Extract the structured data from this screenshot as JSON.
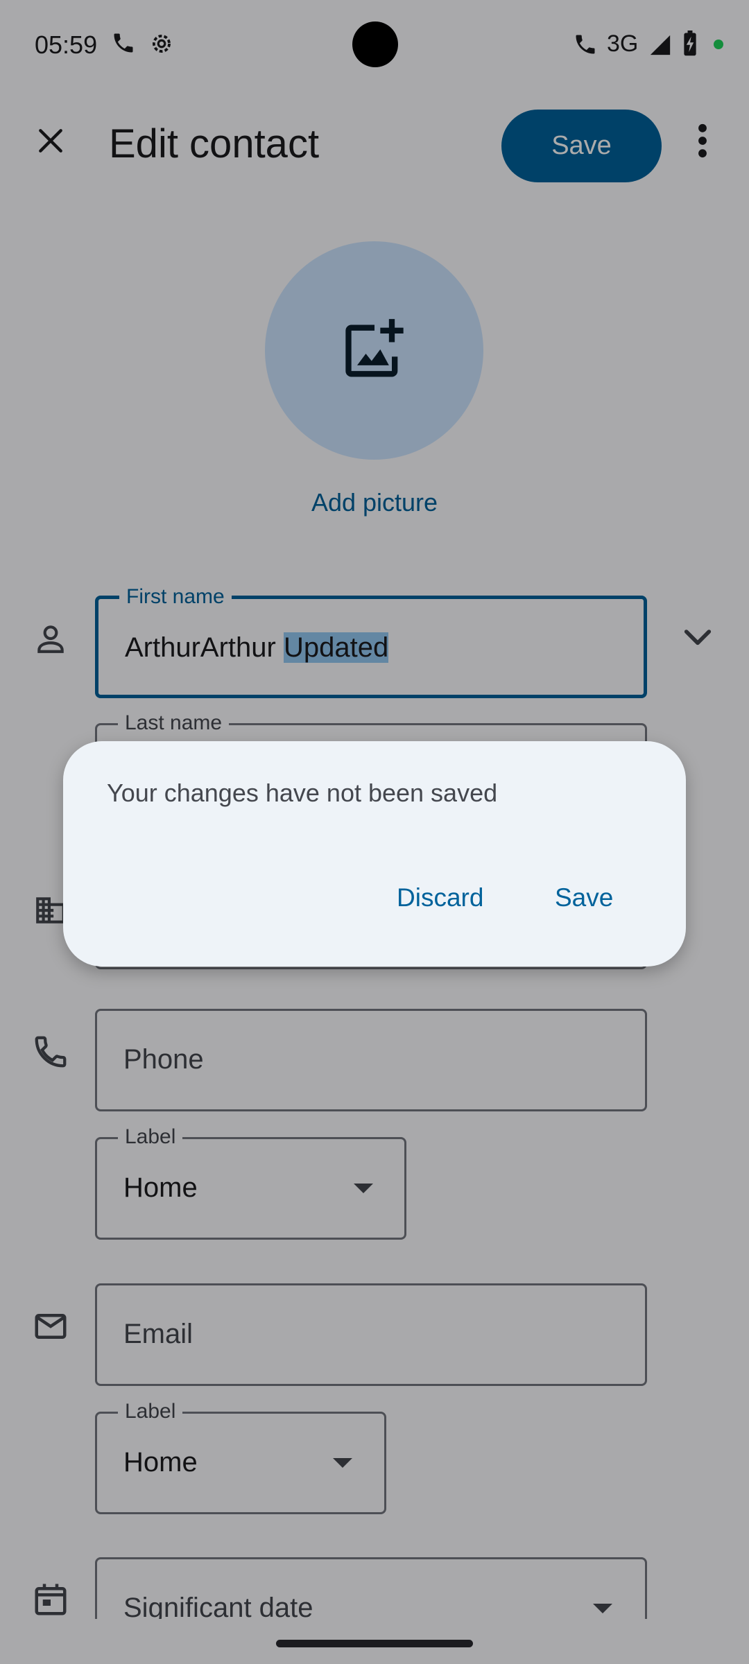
{
  "status_bar": {
    "time": "05:59",
    "network": "3G"
  },
  "top_bar": {
    "title": "Edit contact",
    "save_label": "Save",
    "close_icon": "close-icon",
    "more_icon": "more-vert-icon"
  },
  "avatar": {
    "icon": "add-photo-icon",
    "add_picture_label": "Add picture"
  },
  "fields": {
    "first_name": {
      "label": "First name",
      "value_plain": "ArthurArthur ",
      "value_selected": "Updated"
    },
    "last_name": {
      "label": "Last name"
    },
    "phone": {
      "placeholder": "Phone"
    },
    "phone_label": {
      "label": "Label",
      "value": "Home"
    },
    "email": {
      "placeholder": "Email"
    },
    "email_label": {
      "label": "Label",
      "value": "Home"
    },
    "significant_date": {
      "placeholder": "Significant date"
    }
  },
  "dialog": {
    "message": "Your changes have not been saved",
    "discard_label": "Discard",
    "save_label": "Save"
  },
  "colors": {
    "primary": "#00629b",
    "scrim": "rgba(0,0,0,0.33)",
    "dialog_bg": "#eef3f8"
  }
}
